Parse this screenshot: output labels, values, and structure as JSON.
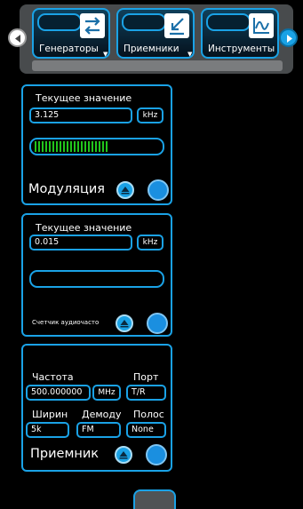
{
  "tabs": [
    {
      "label": "Генераторы",
      "icon": "generators-arrows-icon"
    },
    {
      "label": "Приемники",
      "icon": "receivers-arrows-icon"
    },
    {
      "label": "Инструменты",
      "icon": "instruments-chart-icon"
    }
  ],
  "panel1": {
    "caption": "Текущее значение",
    "value": "3.125",
    "unit": "kHz",
    "meter_level": 0.6,
    "title": "Модуляция"
  },
  "panel2": {
    "caption": "Текущее значение",
    "value": "0.015",
    "unit": "kHz",
    "meter_level": 0,
    "title": "Счетчик аудиочасто"
  },
  "panel3": {
    "freq_label": "Частота",
    "port_label": "Порт",
    "freq_value": "500.000000",
    "freq_unit": "MHz",
    "port_value": "T/R",
    "width_label": "Ширин",
    "demod_label": "Демоду",
    "band_label": "Полос",
    "width_value": "5k",
    "demod_value": "FM",
    "band_value": "None",
    "title": "Приемник"
  },
  "colors": {
    "accent": "#1aa2e6",
    "meter_green": "#22c51c",
    "tab_bar": "#484b4d"
  }
}
